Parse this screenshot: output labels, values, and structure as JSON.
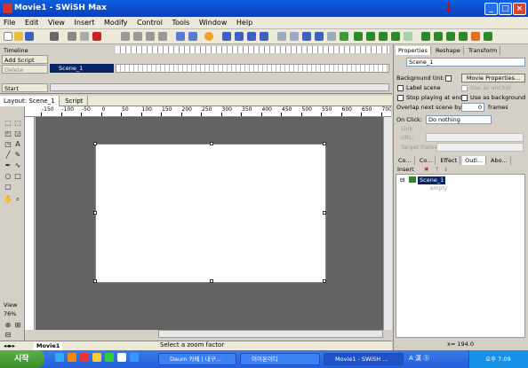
{
  "window": {
    "title": "Movie1 - SWiSH Max",
    "minimize": "_",
    "maximize": "□",
    "close": "×"
  },
  "menu": [
    "File",
    "Edit",
    "View",
    "Insert",
    "Modify",
    "Control",
    "Tools",
    "Window",
    "Help"
  ],
  "timeline": {
    "panel_title": "Timeline",
    "add_script": "Add Script",
    "delete": "Delete",
    "start": "Start",
    "scene_name": "Scene_1"
  },
  "layout_tabs": [
    "Layout: Scene_1",
    "Script"
  ],
  "ruler": {
    "h_ticks": [
      "-150",
      "-100",
      "-50",
      "0",
      "50",
      "100",
      "150",
      "200",
      "250",
      "300",
      "350",
      "400",
      "450",
      "500",
      "550",
      "600",
      "650",
      "700"
    ]
  },
  "view": {
    "label": "View",
    "zoom": "76%"
  },
  "movie_tab": "Movie1",
  "status": "Select a zoom factor",
  "properties": {
    "tabs": [
      "Properties",
      "Reshape",
      "Transform"
    ],
    "scene_name": "Scene_1",
    "background_tint_label": "Background tint:",
    "movie_properties_button": "Movie Properties...",
    "label_scene": "Label scene",
    "use_as_anchor": "Use as anchor",
    "stop_playing": "Stop playing at end",
    "use_as_background": "Use as background",
    "overlap_label": "Overlap next scene by",
    "overlap_value": "0",
    "frames_label": "frames",
    "on_click_label": "On Click:",
    "on_click_value": "Do nothing",
    "link_label": "Link",
    "url_label": "URL:",
    "target_frame_label": "Target frame:"
  },
  "outline": {
    "tabs": [
      "Co...",
      "Co...",
      "Effect",
      "Outl...",
      "Abo..."
    ],
    "insert_label": "Insert",
    "scene_name": "Scene_1",
    "scene_child": "empty",
    "coords": "x= 194.0"
  },
  "taskbar": {
    "start": "시작",
    "tasks": [
      "Daum 카페 | 내구...",
      "이이온이디",
      "Movie1 - SWiSH ..."
    ],
    "clock": "오후 7:09",
    "ime": "A 漢 ⓑ"
  }
}
